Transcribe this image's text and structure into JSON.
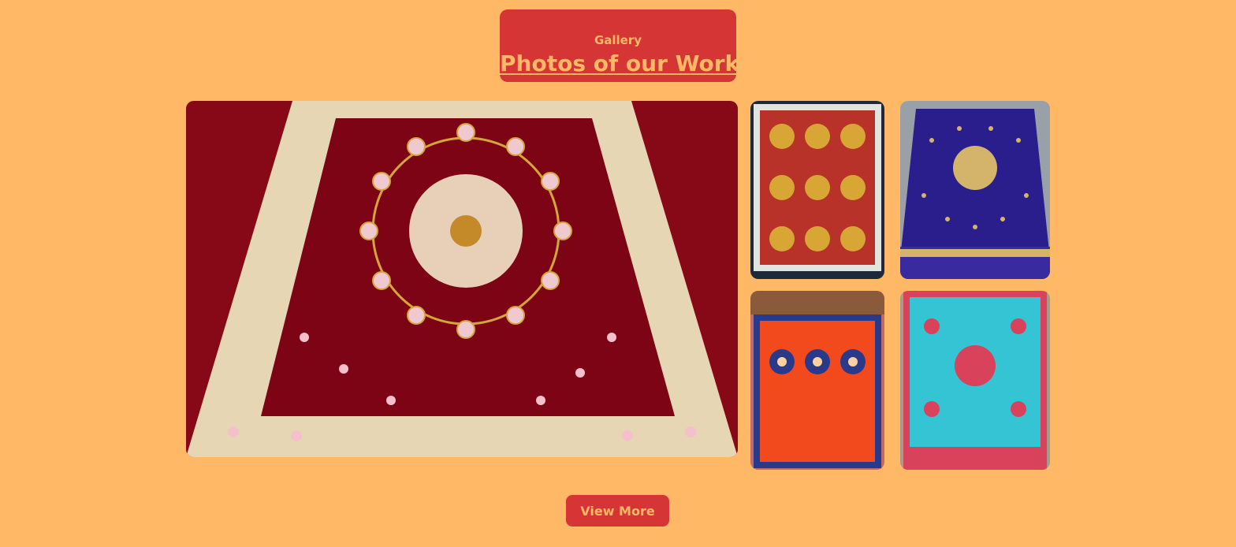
{
  "gallery": {
    "eyebrow": "Gallery",
    "title": "Photos of our Work",
    "button_label": "View More"
  },
  "photos": [
    {
      "label": "Red velvet carpet with gold mandala embroidery",
      "bg": "#7a0012",
      "field": "#8b0a1a",
      "border": "#e8d8b8",
      "accent": "#d4a53a"
    },
    {
      "label": "Gold and red patterned carpet",
      "bg": "#1e2a3a",
      "field": "#b8322a",
      "border": "#e2e4e0",
      "accent": "#d8a635"
    },
    {
      "label": "Royal blue carpet with gold medallion",
      "bg": "#9aa0a8",
      "field": "#2a1e8c",
      "border": "#2a1e8c",
      "accent": "#d4b46a"
    },
    {
      "label": "Orange carpet with blue medallions",
      "bg": "#c06a6a",
      "field": "#f24a1c",
      "border": "#2a3a8a",
      "accent": "#2a3a8a"
    },
    {
      "label": "Turquoise carpet with pink motifs",
      "bg": "#a89a8a",
      "field": "#34c4d4",
      "border": "#d8425a",
      "accent": "#d8425a"
    }
  ]
}
